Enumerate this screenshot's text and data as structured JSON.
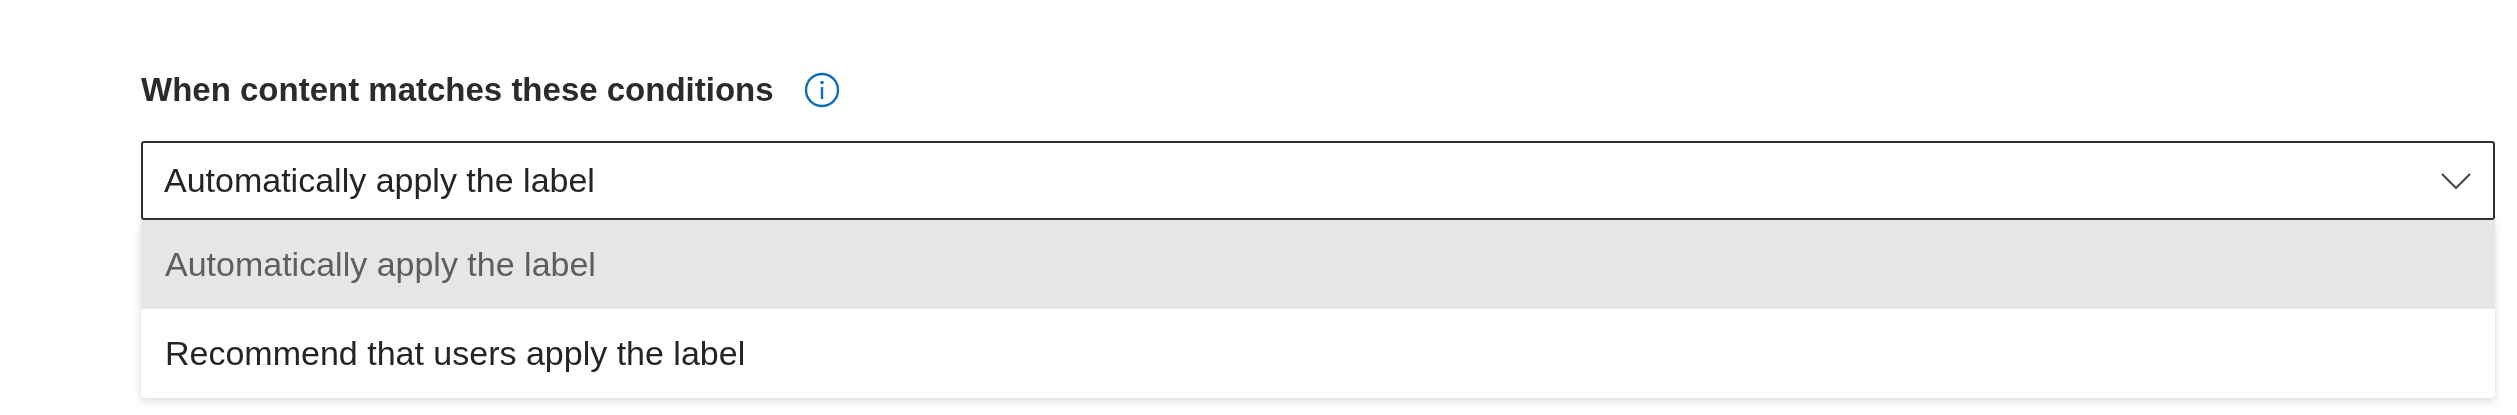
{
  "heading": "When content matches these conditions",
  "dropdown": {
    "value": "Automatically apply the label",
    "expanded": true,
    "options": [
      {
        "label": "Automatically apply the label",
        "selected": true
      },
      {
        "label": "Recommend that users apply the label",
        "selected": false
      }
    ]
  }
}
